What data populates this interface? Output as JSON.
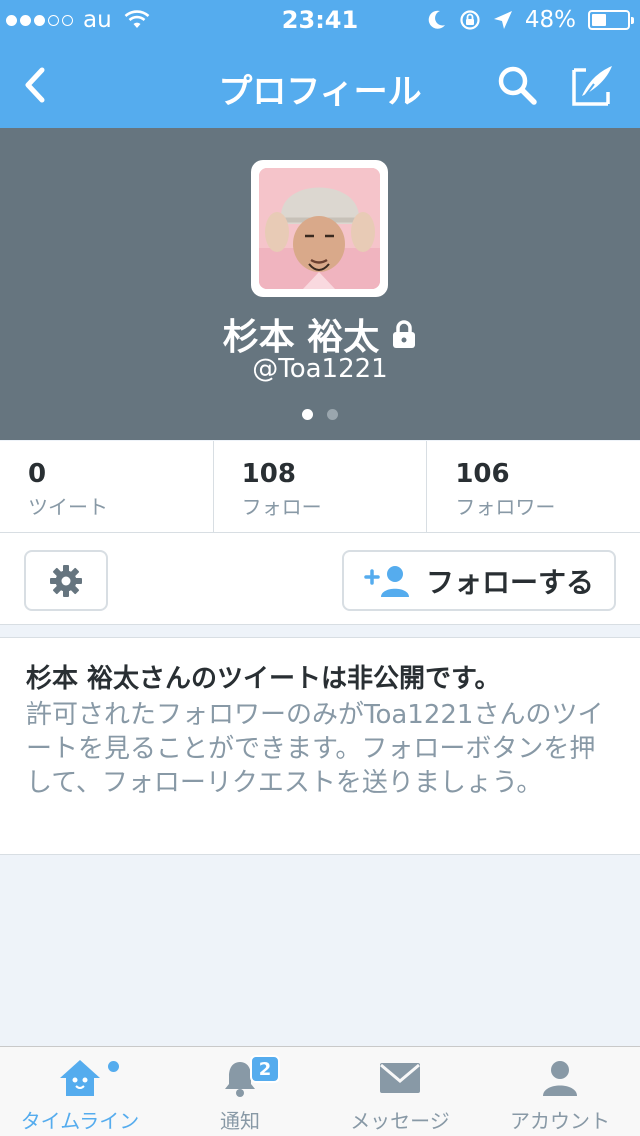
{
  "status_bar": {
    "carrier": "au",
    "time": "23:41",
    "battery": "48%",
    "signal_bars_filled": 3,
    "signal_bars_total": 5,
    "battery_level": 0.48
  },
  "nav": {
    "title": "プロフィール",
    "icons": [
      "back-icon",
      "search-icon",
      "compose-icon"
    ]
  },
  "profile": {
    "name": "杉本 裕太",
    "handle": "@Toa1221",
    "protected_icon": "lock-icon",
    "pages": 2,
    "active_page": 1
  },
  "stats": [
    {
      "value": "0",
      "label": "ツイート"
    },
    {
      "value": "108",
      "label": "フォロー"
    },
    {
      "value": "106",
      "label": "フォロワー"
    }
  ],
  "actions": {
    "settings_icon": "gear-icon",
    "follow_label": "フォローする",
    "follow_icon": "add-user-icon"
  },
  "protected_notice": {
    "title": "杉本 裕太さんのツイートは非公開です。",
    "body": "許可されたフォロワーのみがToa1221さんのツイートを見ることができます。フォローボタンを押して、フォローリクエストを送りましょう。"
  },
  "tabs": [
    {
      "label": "タイムライン",
      "icon": "home-icon",
      "active": true
    },
    {
      "label": "通知",
      "icon": "bell-icon",
      "badge": "2"
    },
    {
      "label": "メッセージ",
      "icon": "envelope-icon"
    },
    {
      "label": "アカウント",
      "icon": "person-icon"
    }
  ],
  "colors": {
    "brand_blue": "#55acee",
    "header_gray": "#66757f",
    "text_dark": "#292f33",
    "text_muted": "#8899a6"
  }
}
